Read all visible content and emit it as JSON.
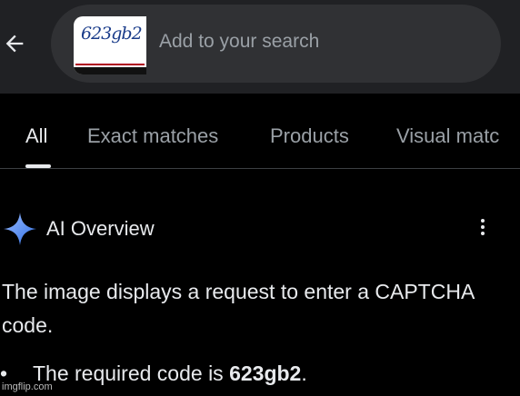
{
  "search": {
    "placeholder": "Add to your search",
    "thumbnail_text": "623gb2"
  },
  "tabs": [
    {
      "label": "All",
      "active": true
    },
    {
      "label": "Exact matches",
      "active": false
    },
    {
      "label": "Products",
      "active": false
    },
    {
      "label": "Visual matc",
      "active": false
    }
  ],
  "ai_overview": {
    "title": "AI Overview",
    "paragraph": "The image displays a request to enter a CAPTCHA code.",
    "bullet_prefix": "The required code is ",
    "bullet_code": "623gb2",
    "bullet_suffix": "."
  },
  "watermark": "imgflip.com",
  "colors": {
    "topbar_bg": "#202124",
    "pill_bg": "#303134",
    "text": "#e8eaed",
    "muted": "#9aa0a6",
    "spark": "#4f8df5"
  }
}
